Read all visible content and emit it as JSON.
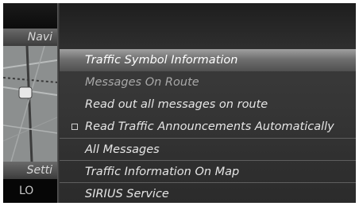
{
  "side": {
    "navi_label": "Navi",
    "settings_label": "Setti",
    "bottom_label": "LO"
  },
  "menu": {
    "items": [
      {
        "label": "Traffic Symbol Information",
        "state": "selected"
      },
      {
        "label": "Messages On Route",
        "state": "disabled"
      },
      {
        "label": "Read out all messages on route",
        "state": "normal"
      },
      {
        "label": "Read Traffic Announcements Automatically",
        "state": "checkbox-unchecked"
      },
      {
        "label": "All Messages",
        "state": "normal"
      },
      {
        "label": "Traffic Information On Map",
        "state": "normal"
      },
      {
        "label": "SIRIUS Service",
        "state": "normal"
      }
    ]
  }
}
